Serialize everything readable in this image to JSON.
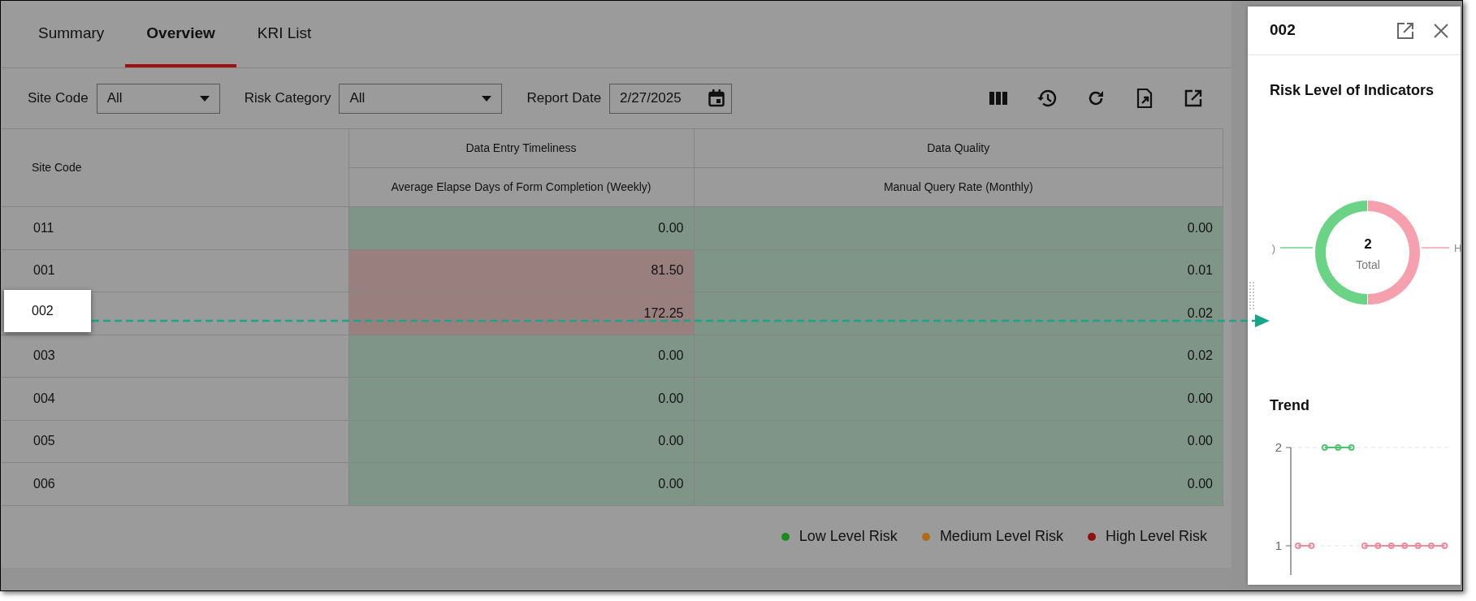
{
  "tabs": [
    {
      "label": "Summary",
      "selected": false
    },
    {
      "label": "Overview",
      "selected": true
    },
    {
      "label": "KRI List",
      "selected": false
    }
  ],
  "filters": [
    {
      "kind": "select",
      "label": "Site Code",
      "value": "All"
    },
    {
      "kind": "select",
      "label": "Risk Category",
      "value": "All"
    },
    {
      "kind": "date",
      "label": "Report Date",
      "value": "2/27/2025"
    }
  ],
  "table": {
    "column_groups": [
      {
        "label": "Data Entry Timeliness"
      },
      {
        "label": "Data Quality"
      }
    ],
    "columns": [
      {
        "label": "Site Code"
      },
      {
        "label": "Average Elapse Days of Form Completion (Weekly)"
      },
      {
        "label": "Manual Query Rate (Monthly)"
      }
    ],
    "rows": [
      {
        "highlighted": false,
        "cells": [
          {
            "value": "011"
          },
          {
            "value": "0.00",
            "color": "#7f9587"
          },
          {
            "value": "0.00",
            "color": "#7f9587"
          }
        ]
      },
      {
        "highlighted": false,
        "cells": [
          {
            "value": "001"
          },
          {
            "value": "81.50",
            "color": "#9a7f7f"
          },
          {
            "value": "0.01",
            "color": "#7f9587"
          }
        ]
      },
      {
        "highlighted": true,
        "cells": [
          {
            "value": "002"
          },
          {
            "value": "172.25",
            "color": "#9a7f7f"
          },
          {
            "value": "0.02",
            "color": "#7f9587"
          }
        ]
      },
      {
        "highlighted": false,
        "cells": [
          {
            "value": "003"
          },
          {
            "value": "0.00",
            "color": "#7f9587"
          },
          {
            "value": "0.02",
            "color": "#7f9587"
          }
        ]
      },
      {
        "highlighted": false,
        "cells": [
          {
            "value": "004"
          },
          {
            "value": "0.00",
            "color": "#7f9587"
          },
          {
            "value": "0.00",
            "color": "#7f9587"
          }
        ]
      },
      {
        "highlighted": false,
        "cells": [
          {
            "value": "005"
          },
          {
            "value": "0.00",
            "color": "#7f9587"
          },
          {
            "value": "0.00",
            "color": "#7f9587"
          }
        ]
      },
      {
        "highlighted": false,
        "cells": [
          {
            "value": "006"
          },
          {
            "value": "0.00",
            "color": "#7f9587"
          },
          {
            "value": "0.00",
            "color": "#7f9587"
          }
        ]
      }
    ]
  },
  "legend": [
    {
      "label": "Low Level Risk",
      "color": "#1d8a1d"
    },
    {
      "label": "Medium Level Risk",
      "color": "#b06c14"
    },
    {
      "label": "High Level Risk",
      "color": "#8e1010"
    }
  ],
  "panel": {
    "title": "002",
    "indicator_title": "Risk Level of Indicators",
    "donut": {
      "total": "2",
      "total_label": "Total",
      "left_label": ")",
      "right_label": "H"
    },
    "trend": {
      "title": "Trend",
      "chart_data": {
        "type": "line",
        "ylim": [
          0.7,
          2
        ],
        "yticks": [
          1,
          2
        ],
        "series": [
          {
            "color": "#4cc46e",
            "marker": "o",
            "values": [
              null,
              null,
              2,
              2,
              2,
              null,
              null,
              null,
              null,
              null,
              null,
              null
            ]
          },
          {
            "color": "#ef8a9a",
            "marker": "o",
            "values": [
              1,
              1,
              null,
              null,
              null,
              1,
              1,
              1,
              1,
              1,
              1,
              1
            ]
          }
        ]
      }
    }
  }
}
